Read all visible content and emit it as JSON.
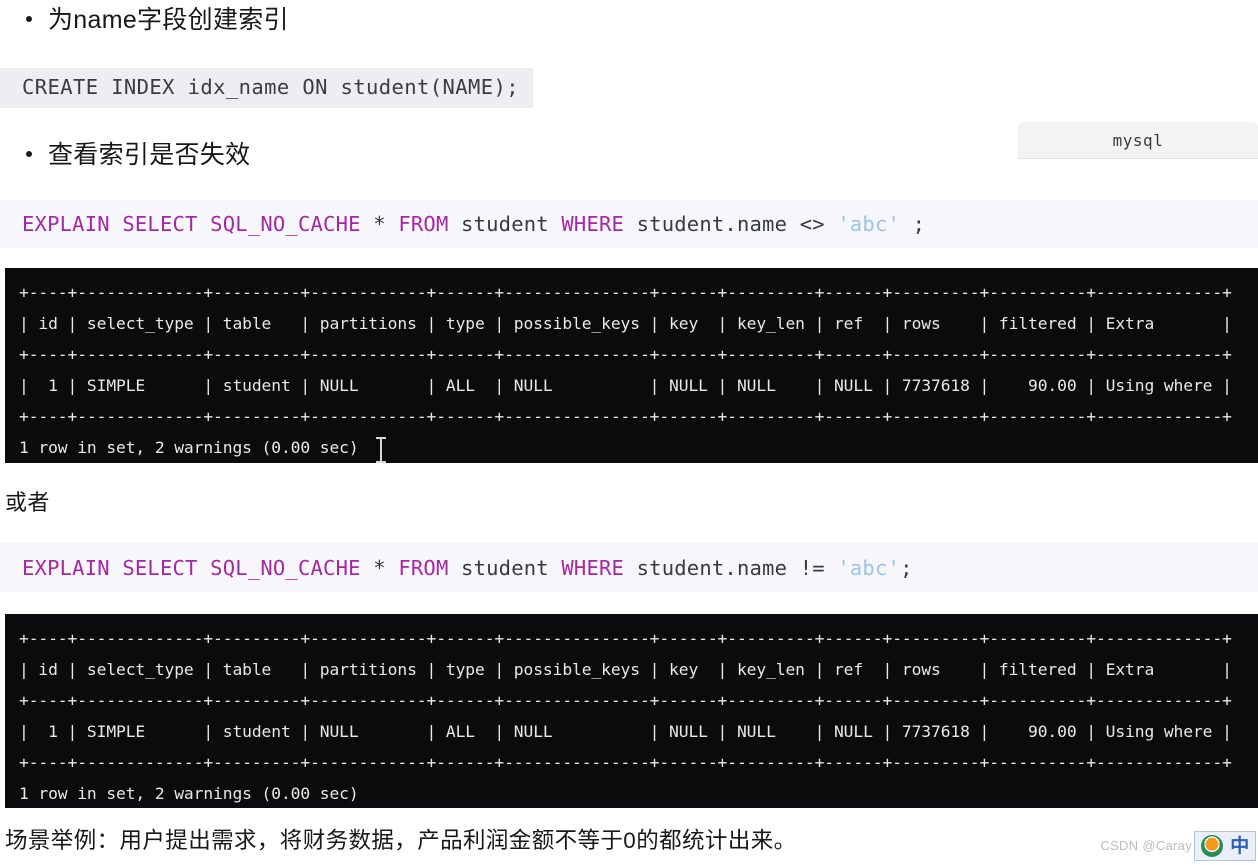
{
  "page": {
    "background": "#ffffff",
    "accent_keyword_color": "#a626a4",
    "string_color": "#9cc4e4",
    "terminal_bg": "#0b0b0d",
    "code_bg": "#f7f7fb",
    "inline_code_bg": "#eceef2"
  },
  "bullets": [
    {
      "text": "为name字段创建索引"
    },
    {
      "text": "查看索引是否失效"
    }
  ],
  "inline_code": {
    "create_index": "CREATE INDEX idx_name ON student(NAME);"
  },
  "mysql_chip": {
    "label": "mysql"
  },
  "sql_blocks": [
    {
      "tokens": {
        "explain": "EXPLAIN",
        "select": "SELECT",
        "no_cache": "SQL_NO_CACHE",
        "star": "*",
        "from": "FROM",
        "table": "student",
        "where": "WHERE",
        "column": "student.name",
        "operator": "<>",
        "value": "'abc'",
        "terminator": ";"
      },
      "full_text": "EXPLAIN SELECT SQL_NO_CACHE * FROM student WHERE student.name <> 'abc' ;"
    },
    {
      "tokens": {
        "explain": "EXPLAIN",
        "select": "SELECT",
        "no_cache": "SQL_NO_CACHE",
        "star": "*",
        "from": "FROM",
        "table": "student",
        "where": "WHERE",
        "column": "student.name",
        "operator": "!=",
        "value": "'abc'",
        "terminator": ";"
      },
      "full_text": "EXPLAIN SELECT SQL_NO_CACHE * FROM student WHERE student.name != 'abc';"
    }
  ],
  "explain_result": {
    "columns": [
      "id",
      "select_type",
      "table",
      "partitions",
      "type",
      "possible_keys",
      "key",
      "key_len",
      "ref",
      "rows",
      "filtered",
      "Extra"
    ],
    "rows": [
      {
        "id": "1",
        "select_type": "SIMPLE",
        "table": "student",
        "partitions": "NULL",
        "type": "ALL",
        "possible_keys": "NULL",
        "key": "NULL",
        "key_len": "NULL",
        "ref": "NULL",
        "rows": "7737618",
        "filtered": "90.00",
        "Extra": "Using where"
      }
    ],
    "status_line": "1 row in set, 2 warnings (0.00 sec)"
  },
  "terminal_1": {
    "body": "+----+-------------+---------+------------+------+---------------+------+---------+------+---------+----------+-------------+\n| id | select_type | table   | partitions | type | possible_keys | key  | key_len | ref  | rows    | filtered | Extra       |\n+----+-------------+---------+------------+------+---------------+------+---------+------+---------+----------+-------------+\n|  1 | SIMPLE      | student | NULL       | ALL  | NULL          | NULL | NULL    | NULL | 7737618 |    90.00 | Using where |\n+----+-------------+---------+------------+------+---------------+------+---------+------+---------+----------+-------------+\n1 row in set, 2 warnings (0.00 sec)"
  },
  "terminal_2": {
    "body": "+----+-------------+---------+------------+------+---------------+------+---------+------+---------+----------+-------------+\n| id | select_type | table   | partitions | type | possible_keys | key  | key_len | ref  | rows    | filtered | Extra       |\n+----+-------------+---------+------------+------+---------------+------+---------+------+---------+----------+-------------+\n|  1 | SIMPLE      | student | NULL       | ALL  | NULL          | NULL | NULL    | NULL | 7737618 |    90.00 | Using where |\n+----+-------------+---------+------------+------+---------------+------+---------+------+---------+----------+-------------+\n1 row in set, 2 warnings (0.00 sec)"
  },
  "paragraphs": {
    "alternative": "或者",
    "scenario": "场景举例：用户提出需求，将财务数据，产品利润金额不等于0的都统计出来。"
  },
  "watermark": {
    "text": "CSDN @Caray"
  },
  "ime": {
    "mode_label": "中"
  }
}
